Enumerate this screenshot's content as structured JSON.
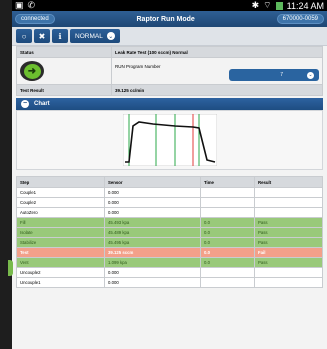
{
  "status_bar": {
    "time": "11:24 AM"
  },
  "app": {
    "connected_label": "connected",
    "title": "Raptor Run Mode",
    "device_id": "670000-0059"
  },
  "toolbar": {
    "mode_label": "NORMAL"
  },
  "info": {
    "status_label": "Status",
    "status_value": "Leak Rate Test (100 sccm) Normal",
    "run_program_label": "RUN Program Number",
    "run_program_value": "7",
    "test_result_label": "Test Result",
    "test_result_value": "39.125 cc/min"
  },
  "chart_panel": {
    "title": "Chart"
  },
  "results": {
    "headers": [
      "Step",
      "Sensor",
      "Time",
      "Result"
    ],
    "rows": [
      {
        "step": "Couple1",
        "sensor": "0.000",
        "time": "",
        "result": "",
        "style": "white"
      },
      {
        "step": "Couple2",
        "sensor": "0.000",
        "time": "",
        "result": "",
        "style": "white"
      },
      {
        "step": "AutoZero",
        "sensor": "0.000",
        "time": "",
        "result": "",
        "style": "white"
      },
      {
        "step": "Fill",
        "sensor": "45.493 kpa",
        "time": "0.0",
        "result": "Pass",
        "style": "green"
      },
      {
        "step": "Isolate",
        "sensor": "45.489 kpa",
        "time": "0.0",
        "result": "Pass",
        "style": "green"
      },
      {
        "step": "Stabilize",
        "sensor": "45.495 kpa",
        "time": "0.0",
        "result": "Pass",
        "style": "green"
      },
      {
        "step": "Test",
        "sensor": "39.125 sccm",
        "time": "0.0",
        "result": "Fail",
        "style": "red"
      },
      {
        "step": "Vent",
        "sensor": "1.099 kpa",
        "time": "0.0",
        "result": "Pass",
        "style": "green"
      },
      {
        "step": "Uncouple2",
        "sensor": "0.000",
        "time": "",
        "result": "",
        "style": "white"
      },
      {
        "step": "Uncouple1",
        "sensor": "0.000",
        "time": "",
        "result": "",
        "style": "white"
      }
    ]
  }
}
